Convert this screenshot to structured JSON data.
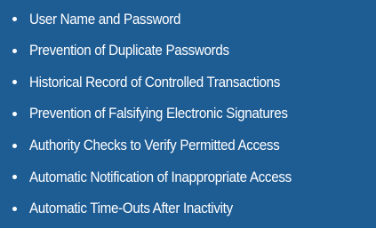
{
  "colors": {
    "background": "#1e5c94",
    "text": "#ffffff"
  },
  "items": [
    {
      "label": "User Name and Password"
    },
    {
      "label": "Prevention of Duplicate Passwords"
    },
    {
      "label": "Historical Record of Controlled Transactions"
    },
    {
      "label": "Prevention of Falsifying Electronic Signatures"
    },
    {
      "label": "Authority Checks to Verify Permitted Access"
    },
    {
      "label": "Automatic Notification of Inappropriate Access"
    },
    {
      "label": "Automatic Time-Outs After Inactivity"
    }
  ]
}
